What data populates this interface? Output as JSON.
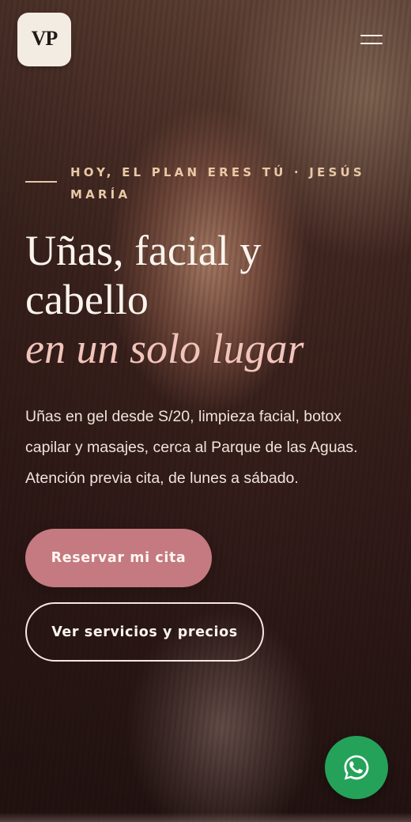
{
  "header": {
    "logo_mark": "VP",
    "logo_subtext": "",
    "menu_icon": "hamburger-menu-icon"
  },
  "hero": {
    "eyebrow": "HOY, EL PLAN ERES TÚ · JESÚS MARÍA",
    "headline_line1": "Uñas, facial y",
    "headline_line2": "cabello",
    "headline_accent": "en un solo lugar",
    "description": "Uñas en gel desde S/20, limpieza facial, botox capilar y masajes, cerca al Parque de las Aguas. Atención previa cita, de lunes a sábado."
  },
  "actions": {
    "primary_label": "Reservar mi cita",
    "secondary_label": "Ver servicios y precios",
    "whatsapp_icon": "whatsapp-icon"
  },
  "colors": {
    "primary_button": "#c47a80",
    "eyebrow": "#e9c8a6",
    "accent_text": "#f2c4bb",
    "whatsapp": "#25a25a",
    "logo_bg": "#f3ece2"
  }
}
